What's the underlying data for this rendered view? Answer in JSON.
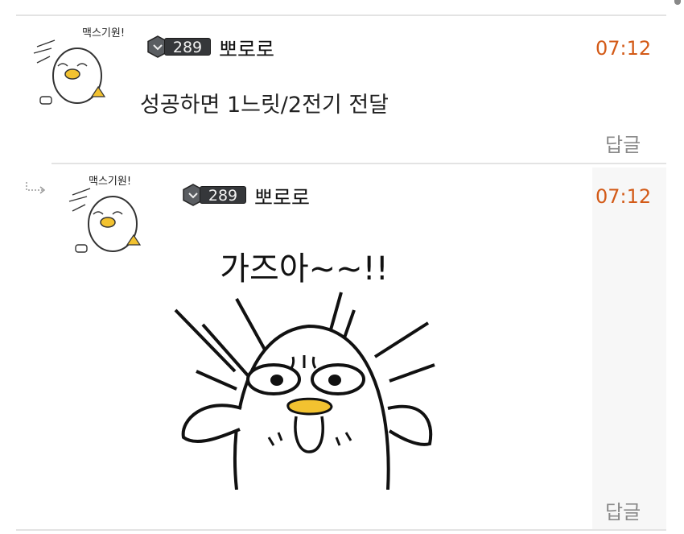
{
  "comments": [
    {
      "level_badge": "289",
      "nickname": "뽀로로",
      "time": "07:12",
      "text": "성공하면 1느릿/2전기 전달",
      "reply_label": "답글",
      "avatar_caption": "맥스기원!",
      "badge_icon": "level-hex-badge"
    },
    {
      "level_badge": "289",
      "nickname": "뽀로로",
      "time": "07:12",
      "sticker_caption": "가즈아~~!!",
      "reply_label": "답글",
      "avatar_caption": "맥스기원!",
      "badge_icon": "level-hex-badge",
      "reply_indicator_icon": "reply-arrow-icon"
    }
  ],
  "colors": {
    "time": "#d35a17",
    "reply": "#8a8a8a",
    "divider": "#e3e3e3",
    "beak": "#f2c230"
  }
}
